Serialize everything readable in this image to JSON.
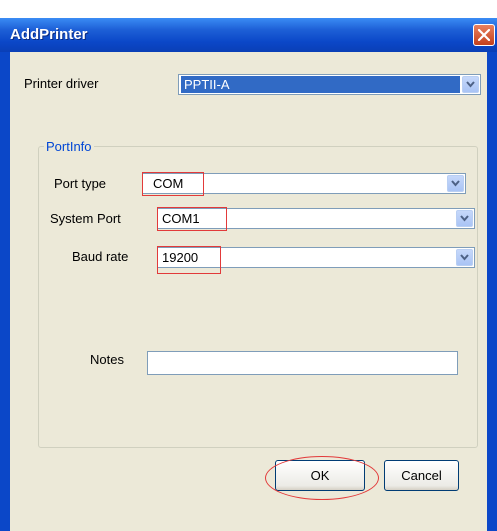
{
  "window": {
    "title": "AddPrinter"
  },
  "form": {
    "printer_driver": {
      "label": "Printer driver",
      "value": "PPTII-A"
    },
    "port_info": {
      "title": "PortInfo"
    },
    "port_type": {
      "label": "Port type",
      "value": "COM"
    },
    "system_port": {
      "label": "System Port",
      "value": "COM1"
    },
    "baud_rate": {
      "label": "Baud rate",
      "value": "19200"
    },
    "notes": {
      "label": "Notes",
      "value": ""
    }
  },
  "buttons": {
    "ok": "OK",
    "cancel": "Cancel"
  },
  "colors": {
    "titlebar": "#0b47c8",
    "window_bg": "#ece9d8",
    "highlight": "#e23a3a",
    "group_title": "#0046d5"
  },
  "icons": {
    "close": "close-icon",
    "dropdown": "chevron-down-icon"
  }
}
